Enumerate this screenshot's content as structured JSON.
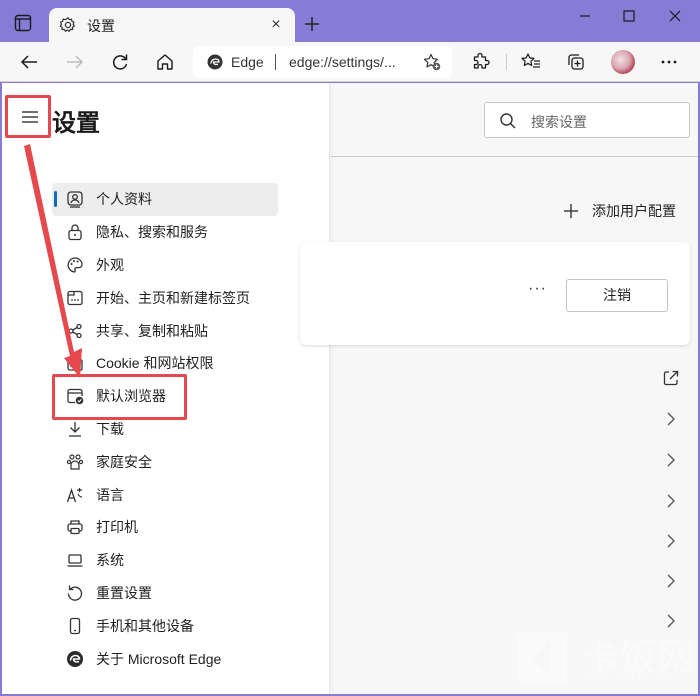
{
  "titlebar": {
    "tab_title": "设置",
    "tab_close": "×",
    "window_controls": [
      "minimize",
      "maximize",
      "close"
    ]
  },
  "toolbar": {
    "address_site": "Edge",
    "address_url": "edge://settings/...",
    "icons": [
      "back-icon",
      "forward-icon",
      "refresh-icon",
      "home-icon",
      "favorite-add-icon",
      "extensions-icon",
      "favorites-icon",
      "collections-icon",
      "profile-avatar",
      "more-icon"
    ]
  },
  "sidebar": {
    "title": "设置",
    "items": [
      {
        "label": "个人资料",
        "icon": "profile-icon",
        "active": true
      },
      {
        "label": "隐私、搜索和服务",
        "icon": "lock-icon"
      },
      {
        "label": "外观",
        "icon": "palette-icon"
      },
      {
        "label": "开始、主页和新建标签页",
        "icon": "new-tab-page-icon"
      },
      {
        "label": "共享、复制和粘贴",
        "icon": "share-icon"
      },
      {
        "label": "Cookie 和网站权限",
        "icon": "site-permissions-icon"
      },
      {
        "label": "默认浏览器",
        "icon": "default-browser-icon",
        "highlighted": true
      },
      {
        "label": "下载",
        "icon": "download-icon"
      },
      {
        "label": "家庭安全",
        "icon": "family-icon"
      },
      {
        "label": "语言",
        "icon": "language-icon"
      },
      {
        "label": "打印机",
        "icon": "printer-icon"
      },
      {
        "label": "系统",
        "icon": "system-icon"
      },
      {
        "label": "重置设置",
        "icon": "reset-icon"
      },
      {
        "label": "手机和其他设备",
        "icon": "phone-icon"
      },
      {
        "label": "关于 Microsoft Edge",
        "icon": "edge-logo-icon"
      }
    ]
  },
  "content": {
    "search_placeholder": "搜索设置",
    "add_profile_label": "添加用户配置",
    "card_more": "···",
    "signout_label": "注销",
    "rows": [
      "external-link",
      "chevron",
      "chevron",
      "chevron",
      "chevron",
      "chevron",
      "chevron"
    ]
  },
  "watermark": {
    "text": "卡饭网",
    "url": "www.kafan.cn"
  },
  "colors": {
    "titlebar": "#867cd6",
    "accent": "#0f6cbd",
    "annotation": "#e5484d"
  }
}
